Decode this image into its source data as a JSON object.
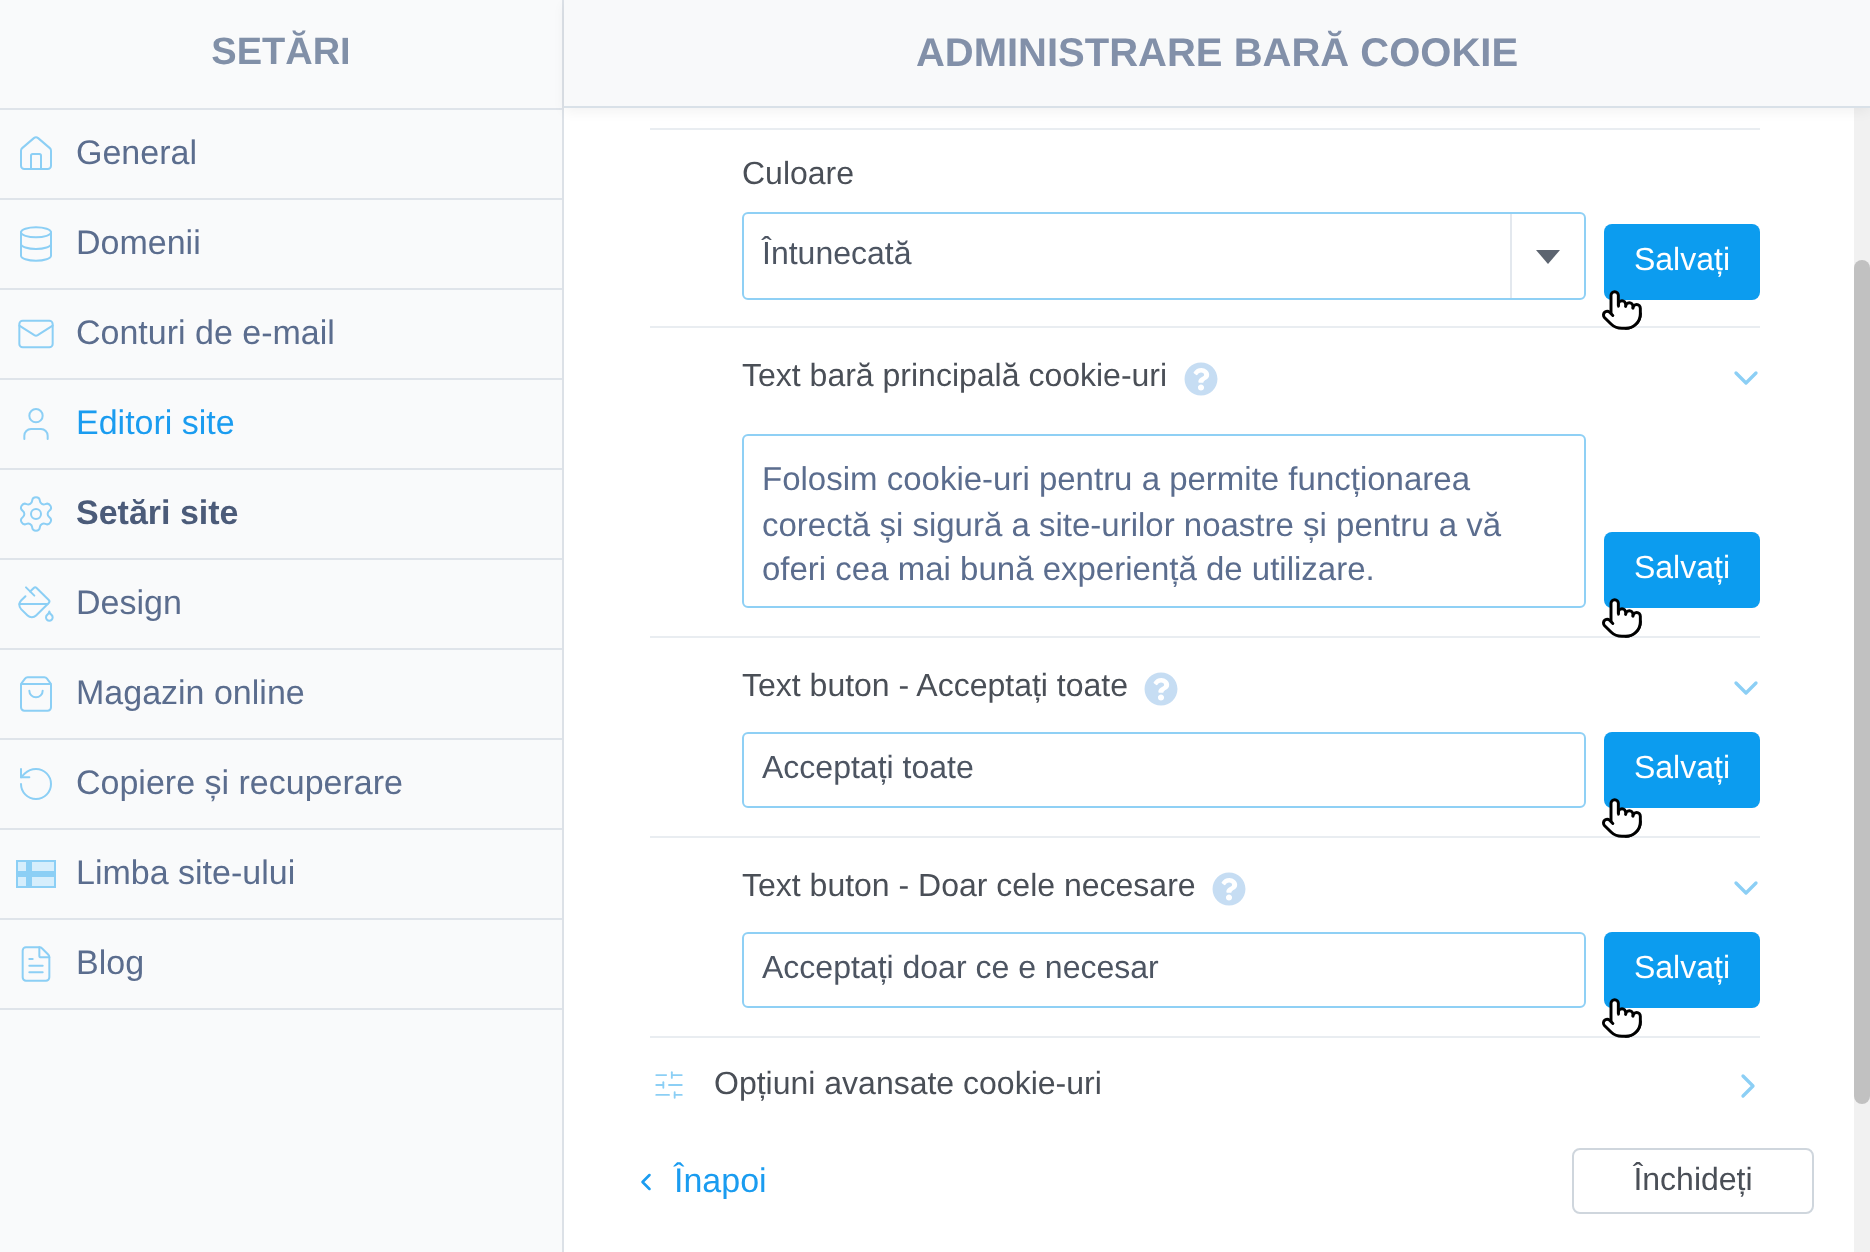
{
  "sidebar": {
    "title": "SETĂRI",
    "items": [
      {
        "label": "General",
        "selected": false,
        "hovered": false
      },
      {
        "label": "Domenii",
        "selected": false,
        "hovered": false
      },
      {
        "label": "Conturi de e-mail",
        "selected": false,
        "hovered": false
      },
      {
        "label": "Editori site",
        "selected": false,
        "hovered": true
      },
      {
        "label": "Setări site",
        "selected": true,
        "hovered": false
      },
      {
        "label": "Design",
        "selected": false,
        "hovered": false
      },
      {
        "label": "Magazin online",
        "selected": false,
        "hovered": false
      },
      {
        "label": "Copiere și recuperare",
        "selected": false,
        "hovered": false
      },
      {
        "label": "Limba site-ului",
        "selected": false,
        "hovered": false
      },
      {
        "label": "Blog",
        "selected": false,
        "hovered": false
      }
    ]
  },
  "panel": {
    "title": "ADMINISTRARE BARĂ COOKIE",
    "settings": [
      {
        "kind": "select",
        "label": "Culoare",
        "value": "Întunecată",
        "help": false,
        "expandable": false,
        "button": {
          "label": "Salvați",
          "hovered": true
        }
      },
      {
        "kind": "textarea",
        "label": "Text bară principală cookie-uri",
        "value": "Folosim cookie-uri pentru a permite funcționarea corectă și sigură a site-urilor noastre și pentru a vă oferi cea mai bună experiență de utilizare.",
        "help": true,
        "expandable": true,
        "button": {
          "label": "Salvați",
          "hovered": true
        }
      },
      {
        "kind": "text",
        "label": "Text buton - Acceptați toate",
        "value": "Acceptați toate",
        "help": true,
        "expandable": true,
        "button": {
          "label": "Salvați",
          "hovered": true
        }
      },
      {
        "kind": "text",
        "label": "Text buton - Doar cele necesare",
        "value": "Acceptați doar ce e necesar",
        "help": true,
        "expandable": true,
        "button": {
          "label": "Salvați",
          "hovered": true
        }
      }
    ],
    "advanced": {
      "label": "Opțiuni avansate cookie-uri"
    },
    "back_link": "Înapoi",
    "close_button": "Închideți"
  }
}
